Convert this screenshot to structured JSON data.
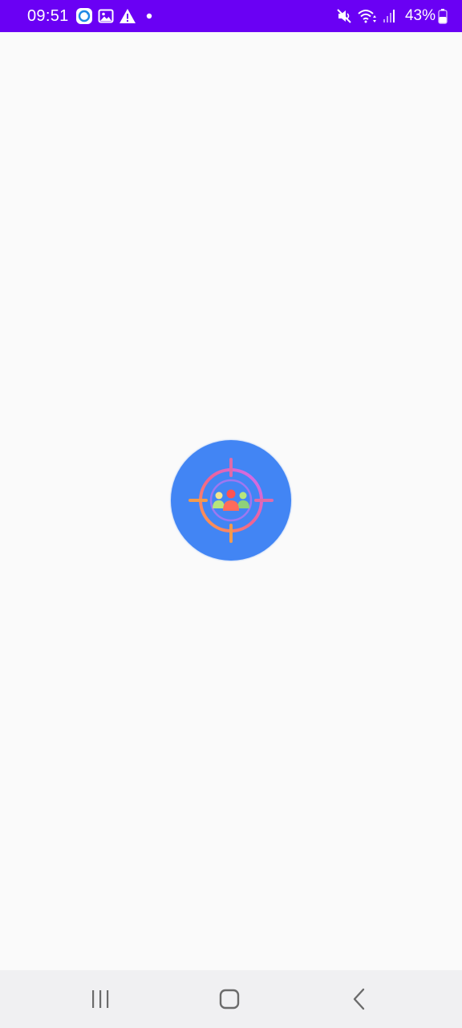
{
  "status_bar": {
    "time": "09:51",
    "battery": "43%",
    "background": "#6a00f4",
    "icons_left": [
      "sync-app-icon",
      "image-icon",
      "warning-icon",
      "dot-icon"
    ],
    "icons_right": [
      "mute-icon",
      "wifi-icon",
      "signal-icon",
      "battery-icon"
    ]
  },
  "splash": {
    "logo_icon": "target-crosshair-people-icon",
    "logo_color": "#4285f4"
  },
  "nav_bar": {
    "buttons": [
      "recent-apps-button",
      "home-button",
      "back-button"
    ]
  }
}
